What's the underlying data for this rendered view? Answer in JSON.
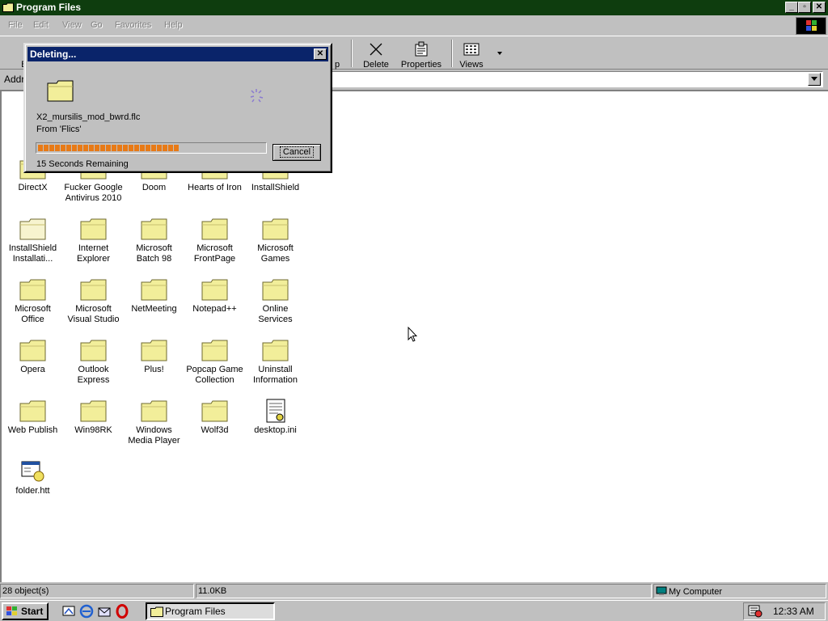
{
  "window": {
    "title": "Program Files",
    "minimize_glyph": "_",
    "maximize_glyph": "▫",
    "close_glyph": "✕"
  },
  "menu": [
    {
      "label": "File"
    },
    {
      "label": "Edit"
    },
    {
      "label": "View"
    },
    {
      "label": "Go"
    },
    {
      "label": "Favorites"
    },
    {
      "label": "Help"
    }
  ],
  "toolbar": {
    "back_label_fragment": "Ba",
    "up_label_fragment": "p",
    "delete_label": "Delete",
    "properties_label": "Properties",
    "views_label": "Views"
  },
  "address": {
    "label_fragment": "Addr"
  },
  "items": [
    {
      "name": "DirectX",
      "icon": "folder-icon"
    },
    {
      "name": "Fucker Google Antivirus 2010",
      "icon": "folder-icon"
    },
    {
      "name": "Doom",
      "icon": "folder-icon"
    },
    {
      "name": "Hearts of Iron",
      "icon": "folder-icon"
    },
    {
      "name": "InstallShield",
      "icon": "folder-icon"
    },
    {
      "name": "InstallShield Installati...",
      "icon": "folder-pale-icon"
    },
    {
      "name": "Internet Explorer",
      "icon": "folder-icon"
    },
    {
      "name": "Microsoft Batch 98",
      "icon": "folder-icon"
    },
    {
      "name": "Microsoft FrontPage",
      "icon": "folder-icon"
    },
    {
      "name": "Microsoft Games",
      "icon": "folder-icon"
    },
    {
      "name": "Microsoft Office",
      "icon": "folder-icon"
    },
    {
      "name": "Microsoft Visual Studio",
      "icon": "folder-icon"
    },
    {
      "name": "NetMeeting",
      "icon": "folder-icon"
    },
    {
      "name": "Notepad++",
      "icon": "folder-icon"
    },
    {
      "name": "Online Services",
      "icon": "folder-icon"
    },
    {
      "name": "Opera",
      "icon": "folder-icon"
    },
    {
      "name": "Outlook Express",
      "icon": "folder-icon"
    },
    {
      "name": "Plus!",
      "icon": "folder-icon"
    },
    {
      "name": "Popcap Game Collection",
      "icon": "folder-icon"
    },
    {
      "name": "Uninstall Information",
      "icon": "folder-icon"
    },
    {
      "name": "Web Publish",
      "icon": "folder-icon"
    },
    {
      "name": "Win98RK",
      "icon": "folder-icon"
    },
    {
      "name": "Windows Media Player",
      "icon": "folder-icon"
    },
    {
      "name": "Wolf3d",
      "icon": "folder-icon"
    },
    {
      "name": "desktop.ini",
      "icon": "ini-file-icon"
    },
    {
      "name": "folder.htt",
      "icon": "htt-file-icon"
    }
  ],
  "status": {
    "objects": "28 object(s)",
    "size": "11.0KB",
    "zone": "My Computer"
  },
  "taskbar": {
    "start_label": "Start",
    "task_label": "Program Files",
    "clock": "12:33 AM"
  },
  "dialog": {
    "title": "Deleting...",
    "file": "X2_mursilis_mod_bwrd.flc",
    "from": "From 'Flics'",
    "remaining": "15 Seconds Remaining",
    "cancel_label": "Cancel",
    "progress": 0.62,
    "close_glyph": "✕"
  },
  "colors": {
    "title_active": "#0a246a",
    "title_window": "#0e3d0e",
    "progress": "#e87a16",
    "folder": "#f2ee9a"
  }
}
